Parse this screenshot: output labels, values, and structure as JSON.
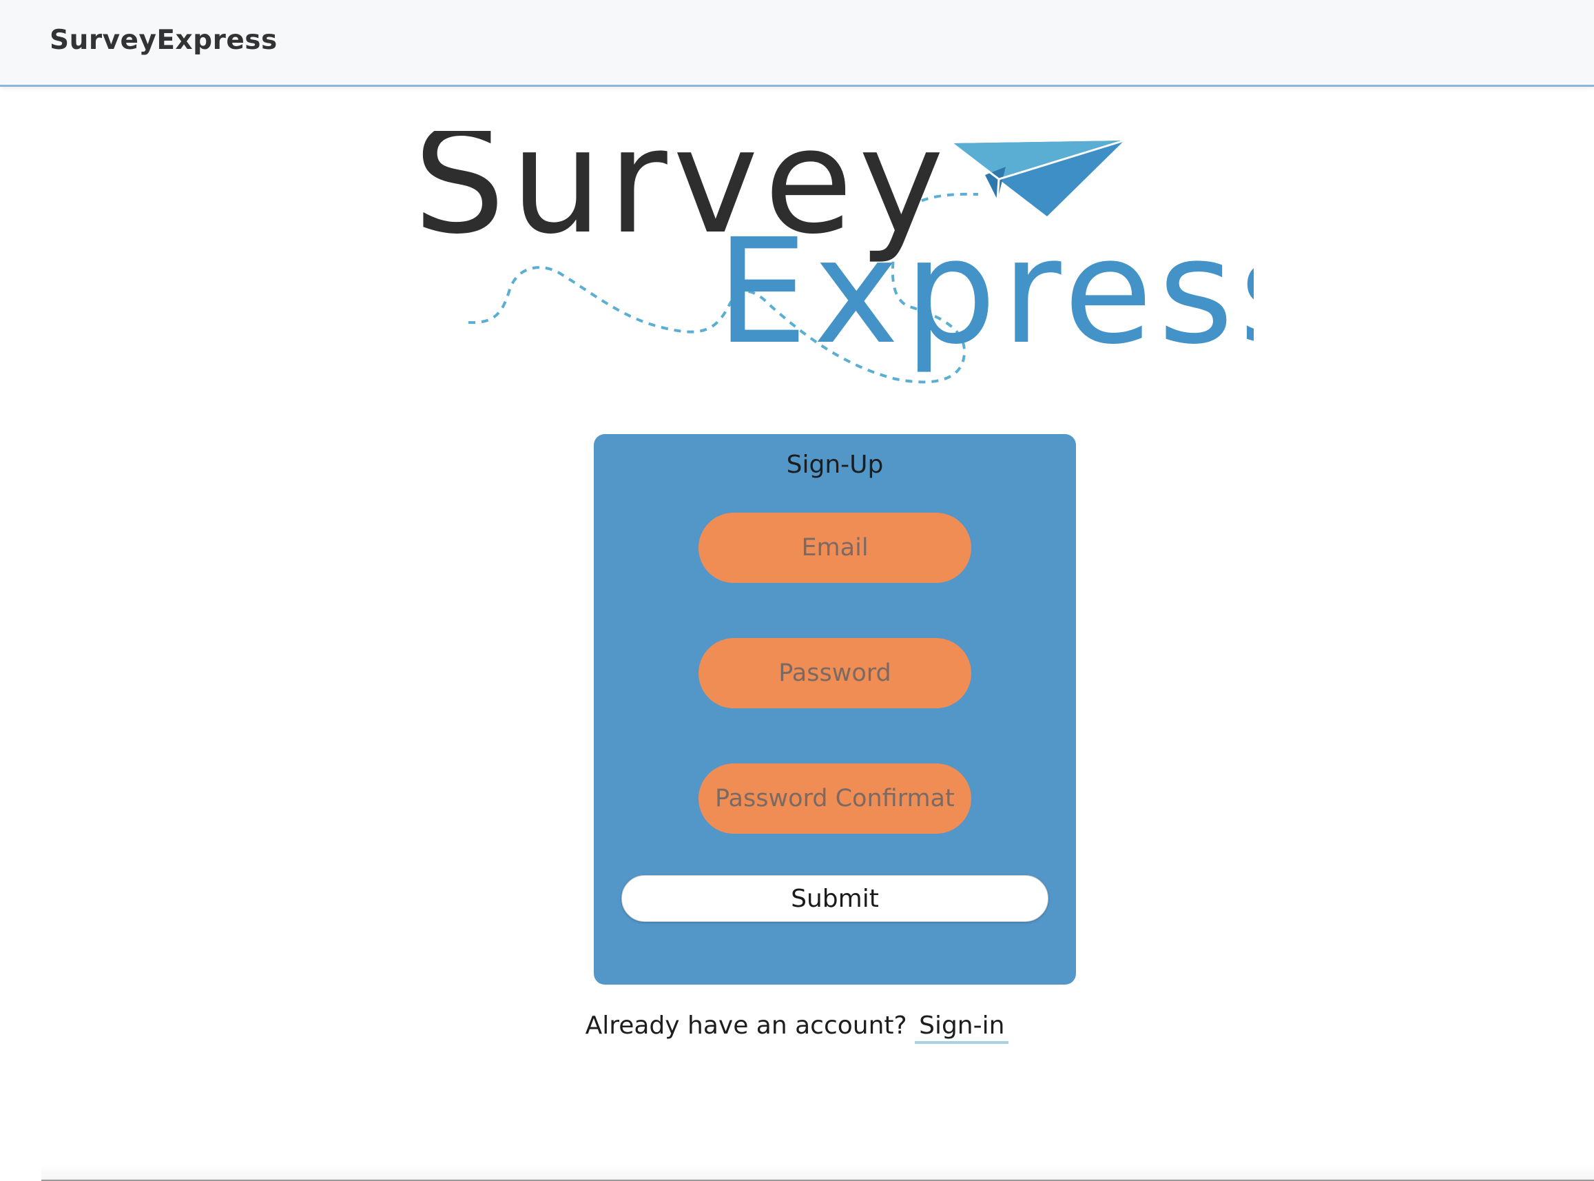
{
  "navbar": {
    "brand": "SurveyExpress"
  },
  "logo": {
    "word_top": "Survey",
    "word_bottom": "Express",
    "colors": {
      "survey": "#2e2e2e",
      "express": "#4393c8",
      "plane": "#3d8fc6",
      "trail": "#5aaed4"
    },
    "icon": "paper-plane-icon"
  },
  "signup": {
    "title": "Sign-Up",
    "email_placeholder": "Email",
    "password_placeholder": "Password",
    "password_confirmation_placeholder": "Password Confirmation",
    "submit_label": "Submit",
    "colors": {
      "card": "#5397c9",
      "input": "#f08d54"
    }
  },
  "footer": {
    "prompt": "Already have an account?",
    "signin_label": "Sign-in"
  }
}
